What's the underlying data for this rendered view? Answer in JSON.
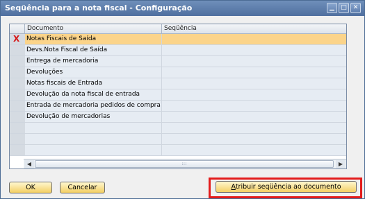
{
  "window": {
    "title": "Seqüência para a nota fiscal - Configuração",
    "controls": {
      "minimize": "▁",
      "maximize": "□",
      "close": "✕"
    }
  },
  "grid": {
    "columns": [
      "Documento",
      "Seqüência"
    ],
    "selected_marker": "X",
    "rows": [
      {
        "documento": "Notas Fiscais de Saída",
        "sequencia": ""
      },
      {
        "documento": "Devs.Nota Fiscal de Saída",
        "sequencia": ""
      },
      {
        "documento": "Entrega de mercadoria",
        "sequencia": ""
      },
      {
        "documento": "Devoluções",
        "sequencia": ""
      },
      {
        "documento": "Notas fiscais de Entrada",
        "sequencia": ""
      },
      {
        "documento": "Devolução da nota fiscal de entrada",
        "sequencia": ""
      },
      {
        "documento": "Entrada de mercadoria pedidos de compra",
        "sequencia": ""
      },
      {
        "documento": "Devolução de mercadorias",
        "sequencia": ""
      },
      {
        "documento": "",
        "sequencia": ""
      },
      {
        "documento": "",
        "sequencia": ""
      },
      {
        "documento": "",
        "sequencia": ""
      }
    ],
    "scroll_left": "◀",
    "scroll_right": "▶",
    "scroll_grip": ":::"
  },
  "buttons": {
    "ok": "OK",
    "cancel": "Cancelar",
    "assign_prefix": "A",
    "assign_rest": "tribuir seqüência ao documento"
  },
  "colors": {
    "selected_row": "#fbd48a",
    "highlight_border": "#e31b1b",
    "title_bar": "#5b7bab"
  }
}
